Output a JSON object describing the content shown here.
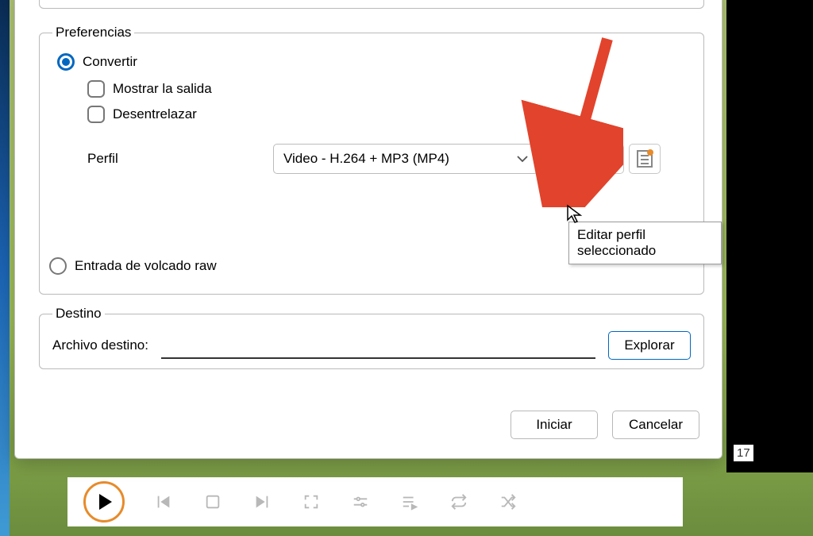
{
  "prefs": {
    "legend": "Preferencias",
    "radio_convert": "Convertir",
    "cb_show_output": "Mostrar la salida",
    "cb_deinterlace": "Desentrelazar",
    "perfil_label": "Perfil",
    "perfil_value": "Video - H.264 + MP3 (MP4)",
    "radio_raw": "Entrada de volcado raw"
  },
  "dest": {
    "legend": "Destino",
    "label": "Archivo destino:",
    "explore": "Explorar",
    "value": ""
  },
  "footer": {
    "start": "Iniciar",
    "cancel": "Cancelar"
  },
  "tooltip": "Editar perfil seleccionado",
  "time": "17"
}
